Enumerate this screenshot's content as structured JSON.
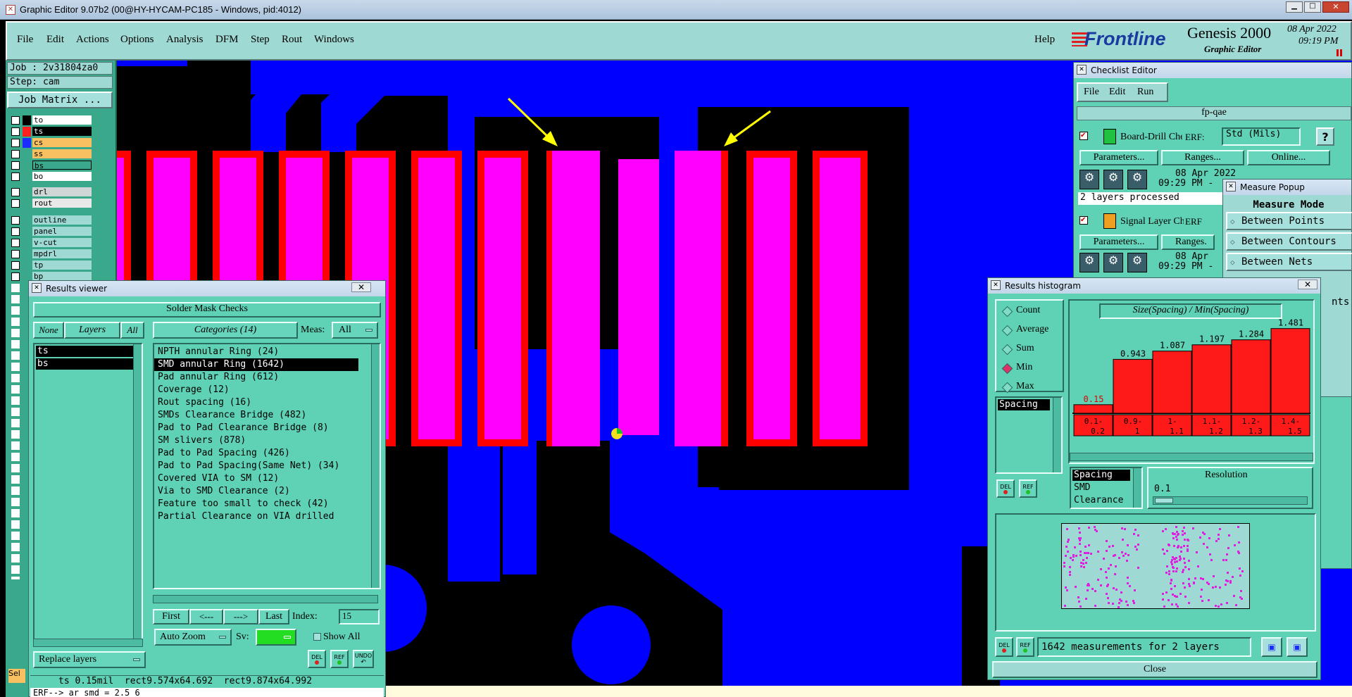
{
  "window": {
    "title": "Graphic Editor 9.07b2 (00@HY-HYCAM-PC185 - Windows, pid:4012)"
  },
  "menu": {
    "items": [
      "File",
      "Edit",
      "Actions",
      "Options",
      "Analysis",
      "DFM",
      "Step",
      "Rout",
      "Windows"
    ],
    "help": "Help"
  },
  "brand": {
    "logo": "Frontline",
    "product": "Genesis 2000",
    "subtitle": "Graphic Editor",
    "date": "08 Apr 2022",
    "time": "09:19 PM"
  },
  "job": {
    "job_label": "Job : 2v31804za0",
    "step_label": "Step: cam",
    "matrix_button": "Job Matrix ..."
  },
  "layers": {
    "group1": [
      {
        "name": "to",
        "color": "#000000",
        "bg": "#ffffff"
      },
      {
        "name": "ts",
        "color": "#ff2020",
        "bg": "#000000"
      },
      {
        "name": "cs",
        "color": "#1a2cff",
        "bg": "#f8c060"
      },
      {
        "name": "ss",
        "color": "#000000",
        "bg": "#f8c060"
      },
      {
        "name": "bs",
        "color": "#000000",
        "bg": "#3aa88a"
      },
      {
        "name": "bo",
        "color": "#000000",
        "bg": "#ffffff"
      }
    ],
    "group2": [
      {
        "name": "drl"
      },
      {
        "name": "rout"
      }
    ],
    "group3": [
      {
        "name": "outline"
      },
      {
        "name": "panel"
      },
      {
        "name": "v-cut"
      },
      {
        "name": "mpdrl"
      },
      {
        "name": "tp"
      },
      {
        "name": "bp"
      }
    ]
  },
  "results_viewer": {
    "title": "Results viewer",
    "header": "Solder Mask Checks",
    "none_btn": "None",
    "layers_btn": "Layers",
    "all_btn": "All",
    "categories_btn": "Categories (14)",
    "meas_label": "Meas:",
    "meas_value": "All",
    "layers_list": [
      "ts",
      "bs"
    ],
    "categories": [
      "NPTH annular Ring (24)",
      "SMD annular Ring (1642)",
      "Pad annular Ring (612)",
      "Coverage (12)",
      "Rout spacing (16)",
      "SMDs Clearance Bridge (482)",
      "Pad to Pad Clearance Bridge (8)",
      "SM slivers (878)",
      "Pad to Pad Spacing (426)",
      "Pad to Pad Spacing(Same Net) (34)",
      "Covered VIA to SM (12)",
      "Via to SMD Clearance (2)",
      "Feature too small to check (42)",
      "Partial Clearance on VIA drilled"
    ],
    "selected_category_index": 1,
    "nav": {
      "first": "First",
      "prev": "<---",
      "next": "--->",
      "last": "Last",
      "index_label": "Index:",
      "index_value": "15"
    },
    "auto_zoom": "Auto Zoom",
    "sv_label": "Sv:",
    "show_all": "Show All",
    "replace_layers": "Replace layers",
    "icons": {
      "del": "DEL",
      "ref": "REF",
      "undo": "UNDO"
    },
    "status": "ts 0.15mil  rect9.574x64.692  rect9.874x64.992",
    "erf_line": "ERF--> ar smd = 2.5 6"
  },
  "checklist_editor": {
    "title": "Checklist Editor",
    "menu": [
      "File",
      "Edit",
      "Run"
    ],
    "name": "fp-qae",
    "check1": {
      "name": "Board-Drill Che",
      "erf_label": "ERF:",
      "erf_value": "Std (Mils)",
      "help": "?"
    },
    "buttons1": [
      "Parameters...",
      "Ranges...",
      "Online..."
    ],
    "run1": {
      "date": "08 Apr 2022",
      "time": "09:29 PM -"
    },
    "status1": "2 layers processed",
    "check2": {
      "name": "Signal Layer Ch",
      "erf_label": "ERF"
    },
    "buttons2": [
      "Parameters...",
      "Ranges."
    ],
    "run2": {
      "date": "08 Apr",
      "time": "09:29 PM -"
    }
  },
  "measure_popup": {
    "title": "Measure Popup",
    "mode_header": "Measure Mode",
    "items": [
      "Between Points",
      "Between Contours",
      "Between Nets"
    ],
    "partial": "nts"
  },
  "histogram": {
    "title": "Results histogram",
    "radios": [
      "Count",
      "Average",
      "Sum",
      "Min",
      "Max"
    ],
    "selected_radio": "Min",
    "chart_title": "Size(Spacing) / Min(Spacing)",
    "list_selected": "Spacing",
    "measure_types": [
      "Spacing",
      "SMD",
      "Clearance"
    ],
    "resolution_label": "Resolution",
    "resolution_value": "0.1",
    "bins": [
      {
        "label1": "0.1-",
        "label2": "0.2",
        "value": 0.15
      },
      {
        "label1": "0.9-",
        "label2": "1",
        "value": 0.943
      },
      {
        "label1": "1-",
        "label2": "1.1",
        "value": 1.087
      },
      {
        "label1": "1.1-",
        "label2": "1.2",
        "value": 1.197
      },
      {
        "label1": "1.2-",
        "label2": "1.3",
        "value": 1.284
      },
      {
        "label1": "1.4-",
        "label2": "1.5",
        "value": 1.481
      }
    ],
    "summary": "1642 measurements for 2 layers",
    "close": "Close",
    "icons": {
      "del": "DEL",
      "ref": "REF"
    }
  },
  "chart_data": {
    "type": "bar",
    "title": "Size(Spacing) / Min(Spacing)",
    "categories": [
      "0.1-0.2",
      "0.9-1",
      "1-1.1",
      "1.1-1.2",
      "1.2-1.3",
      "1.4-1.5"
    ],
    "values": [
      0.15,
      0.943,
      1.087,
      1.197,
      1.284,
      1.481
    ],
    "ylim": [
      0,
      1.6
    ]
  },
  "left_partial": {
    "sel": "Sel"
  }
}
